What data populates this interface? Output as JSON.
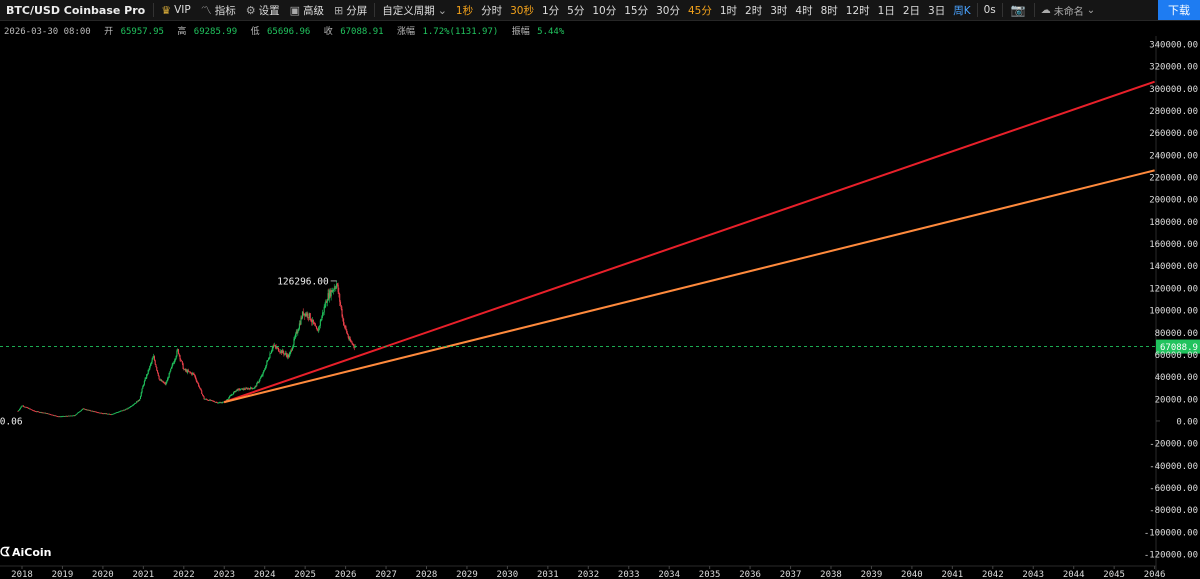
{
  "toolbar": {
    "symbol": "BTC/USD Coinbase Pro",
    "vip": "VIP",
    "indicators": "指标",
    "settings": "设置",
    "advanced": "高级",
    "split": "分屏",
    "custom_period": "自定义周期",
    "periods": [
      "1秒",
      "分时",
      "30秒",
      "1分",
      "5分",
      "10分",
      "15分",
      "30分",
      "45分",
      "1时",
      "2时",
      "3时",
      "4时",
      "8时",
      "12时",
      "1日",
      "2日",
      "3日",
      "周K"
    ],
    "active_periods": [
      "1秒",
      "30秒",
      "45分"
    ],
    "weekly_selected": "周K",
    "zero_seconds": "0s",
    "layout_name": "未命名",
    "download_button": "下载"
  },
  "info": {
    "date": "2026-03-30 08:00",
    "open_label": "开",
    "open": "65957.95",
    "high_label": "高",
    "high": "69285.99",
    "low_label": "低",
    "low": "65696.96",
    "close_label": "收",
    "close": "67088.91",
    "change_label": "涨幅",
    "change": "1.72%(1131.97)",
    "amp_label": "振幅",
    "amp": "5.44%"
  },
  "logo": "AiCoin",
  "chart_data": {
    "type": "candlestick",
    "x_ticks": [
      "2018",
      "2019",
      "2020",
      "2021",
      "2022",
      "2023",
      "2024",
      "2025",
      "2026",
      "2027",
      "2028",
      "2029",
      "2030",
      "2031",
      "2032",
      "2033",
      "2034",
      "2035",
      "2036",
      "2037",
      "2038",
      "2039",
      "2040",
      "2041",
      "2042",
      "2043",
      "2044",
      "2045",
      "2046"
    ],
    "y_ticks": [
      "340000.00",
      "320000.00",
      "300000.00",
      "280000.00",
      "260000.00",
      "240000.00",
      "220000.00",
      "200000.00",
      "180000.00",
      "160000.00",
      "140000.00",
      "120000.00",
      "100000.00",
      "80000.00",
      "60000.00",
      "40000.00",
      "20000.00",
      "0.00",
      "-20000.00",
      "-40000.00",
      "-60000.00",
      "-80000.00",
      "-100000.00",
      "-120000.00"
    ],
    "ylim": [
      -120000,
      340000
    ],
    "last_price": "67088.9",
    "max_label": "126296.00",
    "min_label": "0.06",
    "approx_price_path": [
      {
        "x": 2017.9,
        "y": 9000
      },
      {
        "x": 2018.0,
        "y": 14000
      },
      {
        "x": 2018.3,
        "y": 9000
      },
      {
        "x": 2018.6,
        "y": 7000
      },
      {
        "x": 2018.9,
        "y": 4000
      },
      {
        "x": 2019.3,
        "y": 5000
      },
      {
        "x": 2019.5,
        "y": 11000
      },
      {
        "x": 2019.9,
        "y": 7500
      },
      {
        "x": 2020.2,
        "y": 6000
      },
      {
        "x": 2020.6,
        "y": 11000
      },
      {
        "x": 2020.9,
        "y": 19000
      },
      {
        "x": 2021.0,
        "y": 33000
      },
      {
        "x": 2021.25,
        "y": 58000
      },
      {
        "x": 2021.4,
        "y": 37000
      },
      {
        "x": 2021.55,
        "y": 33000
      },
      {
        "x": 2021.85,
        "y": 64000
      },
      {
        "x": 2022.0,
        "y": 46000
      },
      {
        "x": 2022.25,
        "y": 42000
      },
      {
        "x": 2022.5,
        "y": 20000
      },
      {
        "x": 2022.85,
        "y": 16500
      },
      {
        "x": 2023.0,
        "y": 17000
      },
      {
        "x": 2023.3,
        "y": 28000
      },
      {
        "x": 2023.75,
        "y": 30000
      },
      {
        "x": 2023.95,
        "y": 42000
      },
      {
        "x": 2024.2,
        "y": 68000
      },
      {
        "x": 2024.6,
        "y": 58000
      },
      {
        "x": 2024.95,
        "y": 98000
      },
      {
        "x": 2025.1,
        "y": 95000
      },
      {
        "x": 2025.3,
        "y": 80000
      },
      {
        "x": 2025.55,
        "y": 112000
      },
      {
        "x": 2025.78,
        "y": 124000
      },
      {
        "x": 2025.95,
        "y": 88000
      },
      {
        "x": 2026.1,
        "y": 72000
      },
      {
        "x": 2026.24,
        "y": 67000
      }
    ],
    "trend_lines": [
      {
        "color": "#e8202a",
        "from": {
          "x": 2023.0,
          "y": 17000
        },
        "to": {
          "x": 2046.0,
          "y": 306000
        }
      },
      {
        "color": "#ff8a3d",
        "from": {
          "x": 2023.0,
          "y": 17000
        },
        "to": {
          "x": 2046.0,
          "y": 226000
        }
      }
    ],
    "up_color": "#21c35e",
    "down_color": "#e8404a"
  }
}
